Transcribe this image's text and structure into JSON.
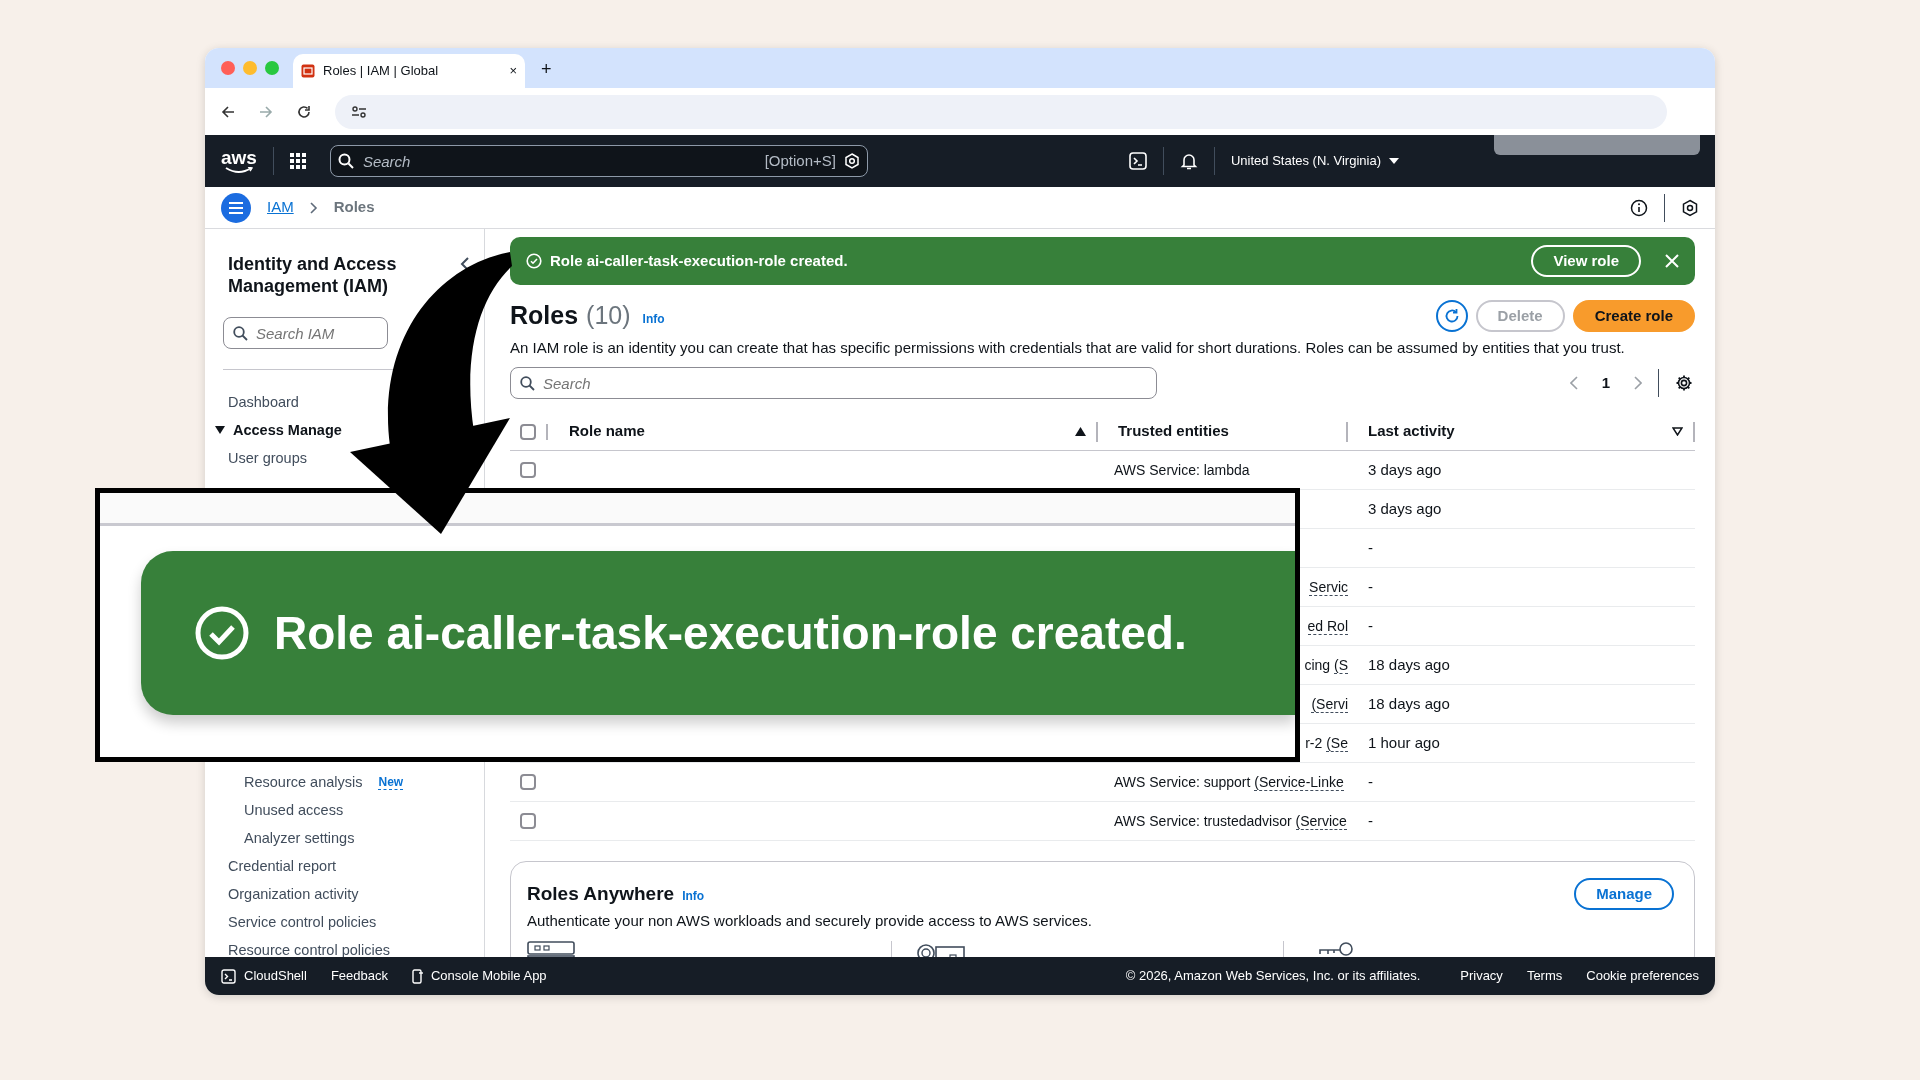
{
  "browser": {
    "tab_title": "Roles | IAM | Global",
    "tab_close": "×",
    "new_tab": "+"
  },
  "top_nav": {
    "logo": "aws",
    "search_placeholder": "Search",
    "shortcut": "[Option+S]",
    "region": "United States (N. Virginia)"
  },
  "breadcrumbs": [
    {
      "label": "IAM",
      "link": true
    },
    {
      "label": "Roles",
      "link": false
    }
  ],
  "sidebar": {
    "title": "Identity and Access Management (IAM)",
    "search_placeholder": "Search IAM",
    "items": [
      {
        "label": "Dashboard"
      },
      {
        "label": "Access Manage",
        "expanded": true,
        "children": [
          {
            "label": "User groups"
          }
        ]
      },
      {
        "children": [
          {
            "label": "Resource analysis",
            "badge": "New"
          },
          {
            "label": "Unused access"
          },
          {
            "label": "Analyzer settings"
          }
        ]
      },
      {
        "label": "Credential report"
      },
      {
        "label": "Organization activity"
      },
      {
        "label": "Service control policies"
      },
      {
        "label": "Resource control policies"
      }
    ]
  },
  "flash": {
    "message": "Role ai-caller-task-execution-role created.",
    "action": "View role"
  },
  "roles": {
    "title": "Roles",
    "count": "(10)",
    "info": "Info",
    "buttons": [
      {
        "label": "Delete",
        "kind": "secondary",
        "disabled": true
      },
      {
        "label": "Create role",
        "kind": "primary",
        "disabled": false
      }
    ],
    "description": "An IAM role is an identity you can create that has specific permissions with credentials that are valid for short durations. Roles can be assumed by entities that you trust.",
    "search_placeholder": "Search",
    "page": "1",
    "select_all_checked": false,
    "columns": [
      {
        "label": "Role name",
        "sorted": true
      },
      {
        "label": "Trusted entities"
      },
      {
        "label": "Last activity",
        "sorted": false
      }
    ],
    "rows": [
      {
        "checked": false,
        "trusted": "AWS Service: lambda",
        "activity": "3 days ago"
      },
      {
        "activity": "3 days ago"
      },
      {
        "activity": "-"
      },
      {
        "clipped": true,
        "trusted_note": "Servic",
        "activity": "-"
      },
      {
        "clipped": true,
        "trusted_note": "ed Rol",
        "activity": "-"
      },
      {
        "clipped": true,
        "trusted": "cing ",
        "trusted_note": "(S",
        "activity": "18 days ago"
      },
      {
        "clipped": true,
        "trusted_note": "(Servi",
        "activity": "18 days ago"
      },
      {
        "clipped": true,
        "trusted": "r-2 ",
        "trusted_note": "(Se",
        "activity": "1 hour ago"
      },
      {
        "checked": false,
        "trusted": "AWS Service: support ",
        "trusted_note": "(Service-Linke",
        "activity": "-"
      },
      {
        "checked": false,
        "trusted": "AWS Service: trustedadvisor ",
        "trusted_note": "(Service",
        "activity": "-"
      }
    ]
  },
  "roles_anywhere": {
    "title": "Roles Anywhere",
    "info": "Info",
    "description": "Authenticate your non AWS workloads and securely provide access to AWS services.",
    "button": "Manage"
  },
  "footer": {
    "left": [
      {
        "label": "CloudShell",
        "kind": "terminal"
      },
      {
        "label": "Feedback",
        "kind": "plain"
      },
      {
        "label": "Console Mobile App",
        "kind": "phone"
      }
    ],
    "copyright": "© 2026, Amazon Web Services, Inc. or its affiliates.",
    "links": [
      "Privacy",
      "Terms",
      "Cookie preferences"
    ]
  },
  "callout": {
    "message": "Role ai-caller-task-execution-role created."
  }
}
